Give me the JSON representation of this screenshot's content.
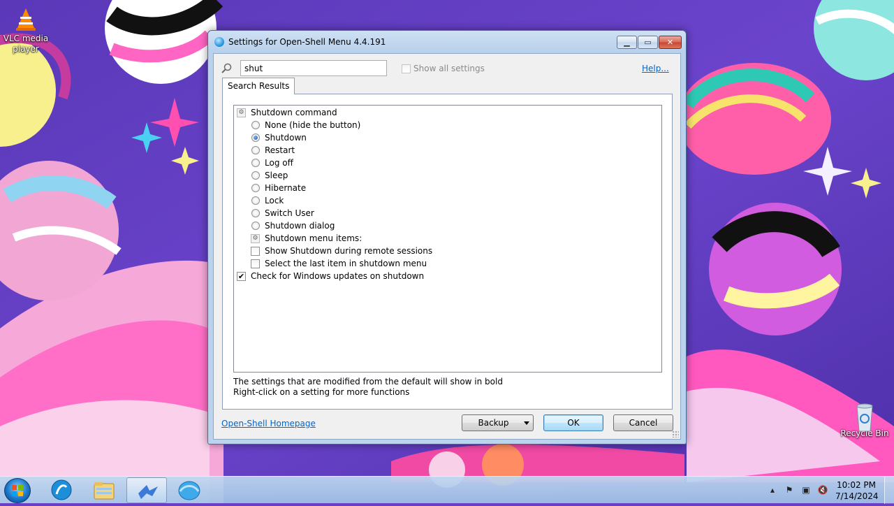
{
  "desktop": {
    "icons": [
      {
        "label": "VLC media player"
      },
      {
        "label": "Recycle Bin"
      }
    ]
  },
  "window": {
    "title": "Settings for Open-Shell Menu 4.4.191",
    "search": {
      "value": "shut",
      "placeholder": ""
    },
    "show_all_label": "Show all settings",
    "show_all_checked": false,
    "help_label": "Help...",
    "tab_label": "Search Results",
    "settings": [
      {
        "label": "Shutdown command",
        "kind": "group",
        "indent": 0
      },
      {
        "label": "None (hide the button)",
        "kind": "radio",
        "checked": false,
        "indent": 1
      },
      {
        "label": "Shutdown",
        "kind": "radio",
        "checked": true,
        "indent": 1
      },
      {
        "label": "Restart",
        "kind": "radio",
        "checked": false,
        "indent": 1
      },
      {
        "label": "Log off",
        "kind": "radio",
        "checked": false,
        "indent": 1
      },
      {
        "label": "Sleep",
        "kind": "radio",
        "checked": false,
        "indent": 1
      },
      {
        "label": "Hibernate",
        "kind": "radio",
        "checked": false,
        "indent": 1
      },
      {
        "label": "Lock",
        "kind": "radio",
        "checked": false,
        "indent": 1
      },
      {
        "label": "Switch User",
        "kind": "radio",
        "checked": false,
        "indent": 1
      },
      {
        "label": "Shutdown dialog",
        "kind": "radio",
        "checked": false,
        "indent": 1
      },
      {
        "label": "Shutdown menu items:",
        "kind": "group",
        "indent": 1
      },
      {
        "label": "Show Shutdown during remote sessions",
        "kind": "checkbox",
        "checked": false,
        "indent": 1
      },
      {
        "label": "Select the last item in shutdown menu",
        "kind": "checkbox",
        "checked": false,
        "indent": 1
      },
      {
        "label": "Check for Windows updates on shutdown",
        "kind": "checkbox",
        "checked": true,
        "indent": 0
      }
    ],
    "note_line1": "The settings that are modified from the default will show in bold",
    "note_line2": "Right-click on a setting for more functions",
    "homepage_label": "Open-Shell Homepage",
    "backup_label": "Backup",
    "ok_label": "OK",
    "cancel_label": "Cancel"
  },
  "taskbar": {
    "apps": [
      "start-button",
      "open-shell-app",
      "file-explorer",
      "open-shell-settings",
      "app-shell-icon"
    ],
    "clock_time": "10:02 PM",
    "clock_date": "7/14/2024"
  }
}
